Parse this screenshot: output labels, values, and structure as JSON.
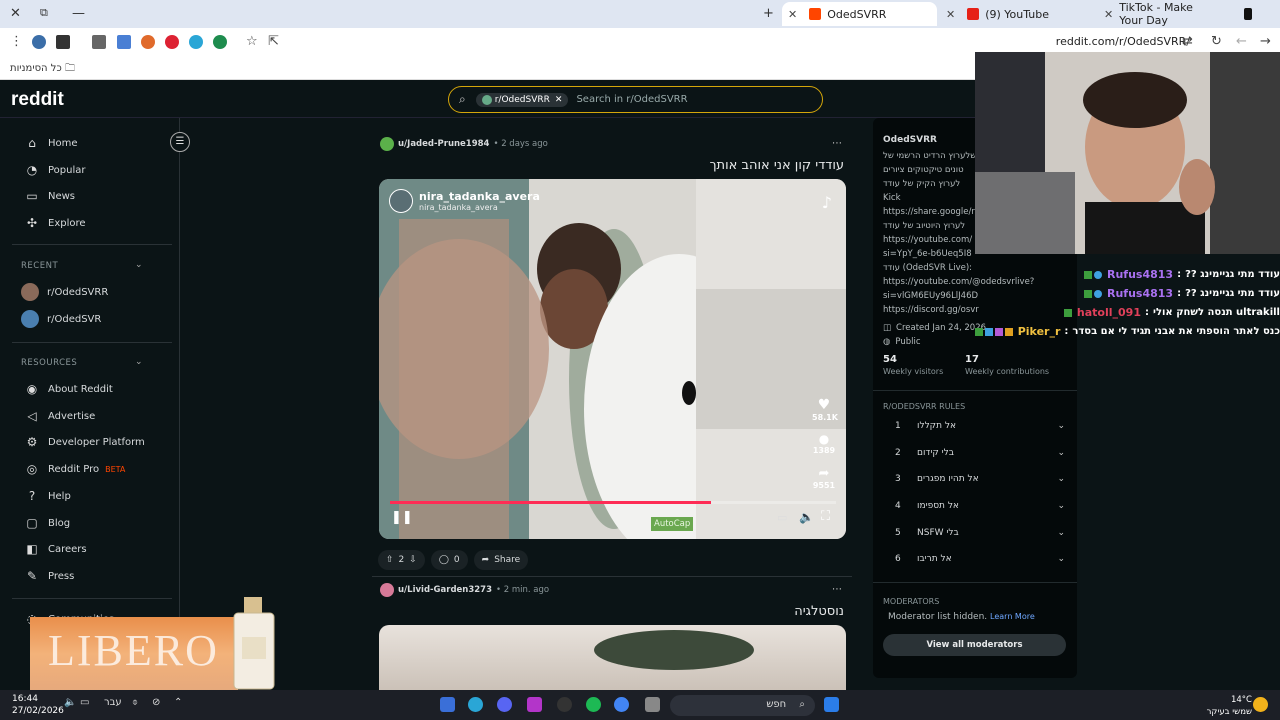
{
  "browser": {
    "tabs": [
      {
        "label": "OdedSVRR",
        "active": true
      },
      {
        "label": "(9) YouTube",
        "active": false
      },
      {
        "label": "TikTok - Make Your Day",
        "active": false
      }
    ],
    "url": "reddit.com/r/OdedSVRR/",
    "bookmarks_label": "כל הסימניות"
  },
  "reddit": {
    "logo": "reddit",
    "search": {
      "chip": "r/OdedSVRR",
      "placeholder": "Search in r/OdedSVRR"
    }
  },
  "sidebar": {
    "nav": [
      "Home",
      "Popular",
      "News",
      "Explore"
    ],
    "recent_header": "RECENT",
    "recent": [
      "r/OdedSVRR",
      "r/OdedSVR"
    ],
    "resources_header": "RESOURCES",
    "resources": [
      "About Reddit",
      "Advertise",
      "Developer Platform",
      "Reddit Pro",
      "Help",
      "Blog",
      "Careers",
      "Press"
    ],
    "beta": "BETA",
    "communities": "Communities"
  },
  "posts": [
    {
      "user": "u/Jaded-Prune1984",
      "time": "2 days ago",
      "title": "עודדי קון אני אוהב אותך",
      "video": {
        "account": "nira_tadanka_avera",
        "account_sub": "nira_tadanka_avera",
        "likes": "58.1K",
        "comments": "1389",
        "shares": "9551",
        "autocap": "AutoCap",
        "progress": 0.72
      },
      "votes": "2",
      "comments": "0",
      "share": "Share"
    },
    {
      "user": "u/Livid-Garden3273",
      "time": "2 min. ago",
      "title": "נוסטלגיה"
    }
  ],
  "right_panel": {
    "name": "OdedSVRR",
    "desc_lines": [
      "שלערוץ הרדיט הרשמי של",
      "טונים טיקטוקים ציורים",
      "לערוץ הקיק של עודד",
      "Kick",
      "https://share.google/r",
      "לערוץ היוטיוב של עודד",
      "https://youtube.com/",
      "si=YpY_6e-b6Ueq5I8",
      "עודד (OdedSVR Live):",
      "https://youtube.com/@odedsvrlive?",
      "si=vlGM6EUy96LlJ46D",
      "https://discord.gg/osvr"
    ],
    "created": "Created Jan 24, 2026",
    "visibility": "Public",
    "stats": [
      {
        "value": "54",
        "label": "Weekly visitors"
      },
      {
        "value": "17",
        "label": "Weekly contributions"
      }
    ],
    "rules_header": "R/ODEDSVRR RULES",
    "rules": [
      "אל תקללו",
      "בלי קידום",
      "אל תהיו מפגרים",
      "אל תספימו",
      "בלי NSFW",
      "אל תריבו"
    ],
    "moderators_header": "MODERATORS",
    "moderators_text": "Moderator list hidden.",
    "learn_more": "Learn More",
    "view_all": "View all moderators"
  },
  "chat": [
    {
      "name": "Rufus4813",
      "msg": "עודד מתי גגיימינג ??"
    },
    {
      "name": "Rufus4813",
      "msg": "עודד מתי גגיימינג ??"
    },
    {
      "name": "hatoll_091",
      "msg": "ultrakill תנסה לשחק אולי"
    },
    {
      "name": "Piker_r",
      "msg": "כנס לאתר הוספתי את אבני תגיד לי אם בסדר"
    }
  ],
  "ad": {
    "brand": "LIBERO"
  },
  "taskbar": {
    "time": "16:44",
    "date": "27/02/2026",
    "lang": "עבר",
    "search": "חפש",
    "temp": "14°C",
    "weather": "שמשי בעיקר"
  }
}
